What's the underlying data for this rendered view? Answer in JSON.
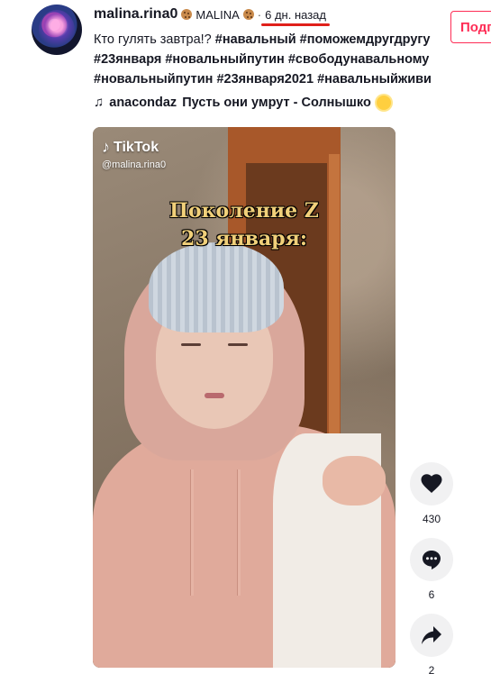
{
  "post": {
    "username": "malina.rina0",
    "nickname": "MALINA",
    "separator": "·",
    "time_ago": "6 дн. назад",
    "follow_label": "Подп",
    "caption_text": "Кто гулять завтра!? ",
    "hashtags": [
      "#навальный",
      "#поможемдругдругу",
      "#23января",
      "#новальныйпутин",
      "#свободунавальному",
      "#новальныйпутин",
      "#23января2021",
      "#навальныйживи"
    ],
    "music": {
      "artist": "anacondaz",
      "song": "Пусть они умрут - Солнышко"
    }
  },
  "video": {
    "watermark_brand": "TikTok",
    "watermark_handle": "@malina.rina0",
    "overlay_line1": "Поколение Z",
    "overlay_line2": "23 января:"
  },
  "actions": {
    "likes": "430",
    "comments": "6",
    "shares": "2"
  },
  "colors": {
    "accent": "#fe2c55",
    "time_underline": "#e0201a",
    "overlay_text": "#f1d07a"
  },
  "icons": {
    "like": "heart-icon",
    "comment": "comment-icon",
    "share": "share-icon",
    "music": "music-note-icon"
  }
}
